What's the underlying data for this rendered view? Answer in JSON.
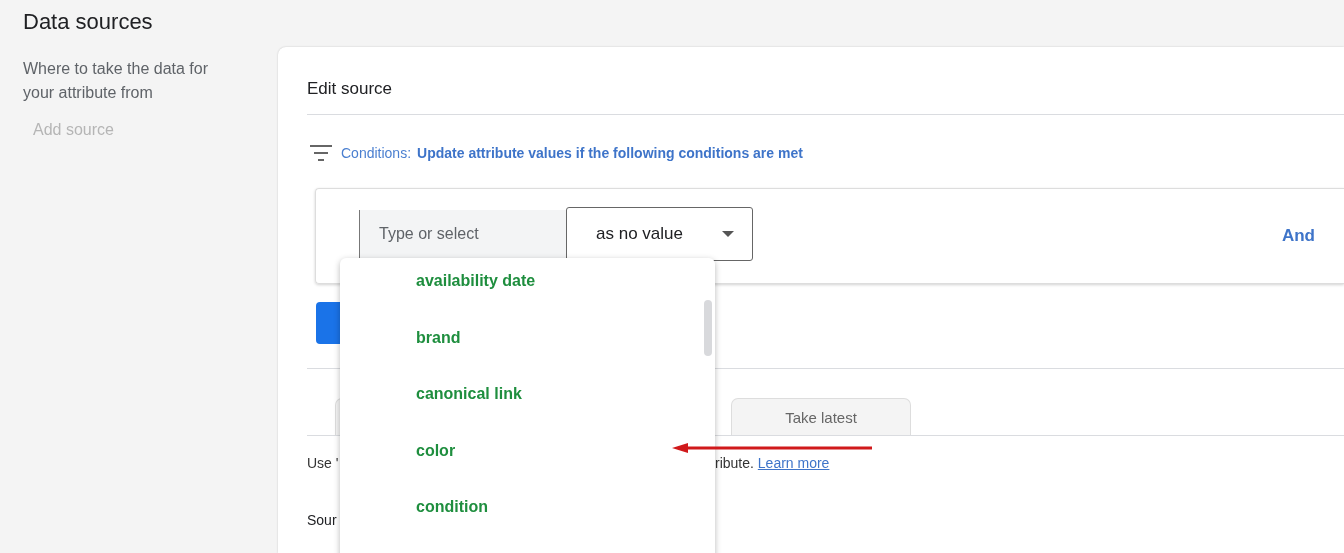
{
  "page_title": "Data sources",
  "sidebar": {
    "description": "Where to take the data for your attribute from",
    "add_source": "Add source"
  },
  "editor": {
    "title": "Edit source",
    "conditions": {
      "label": "Conditions:",
      "text": "Update attribute values if the following conditions are met"
    },
    "condition_row": {
      "attribute_field": {
        "placeholder": "Type or select"
      },
      "operator": "as no value",
      "and_button": "And"
    },
    "tabs": [
      {
        "label": "Take latest",
        "selected": false
      }
    ],
    "help": {
      "text_start": "Use '",
      "text_end": "ribute.",
      "link": "Learn more"
    },
    "source_label": "Sour"
  },
  "dropdown": {
    "items": [
      {
        "label": "availability date"
      },
      {
        "label": "brand"
      },
      {
        "label": "canonical link"
      },
      {
        "label": "color"
      },
      {
        "label": "condition"
      }
    ]
  }
}
